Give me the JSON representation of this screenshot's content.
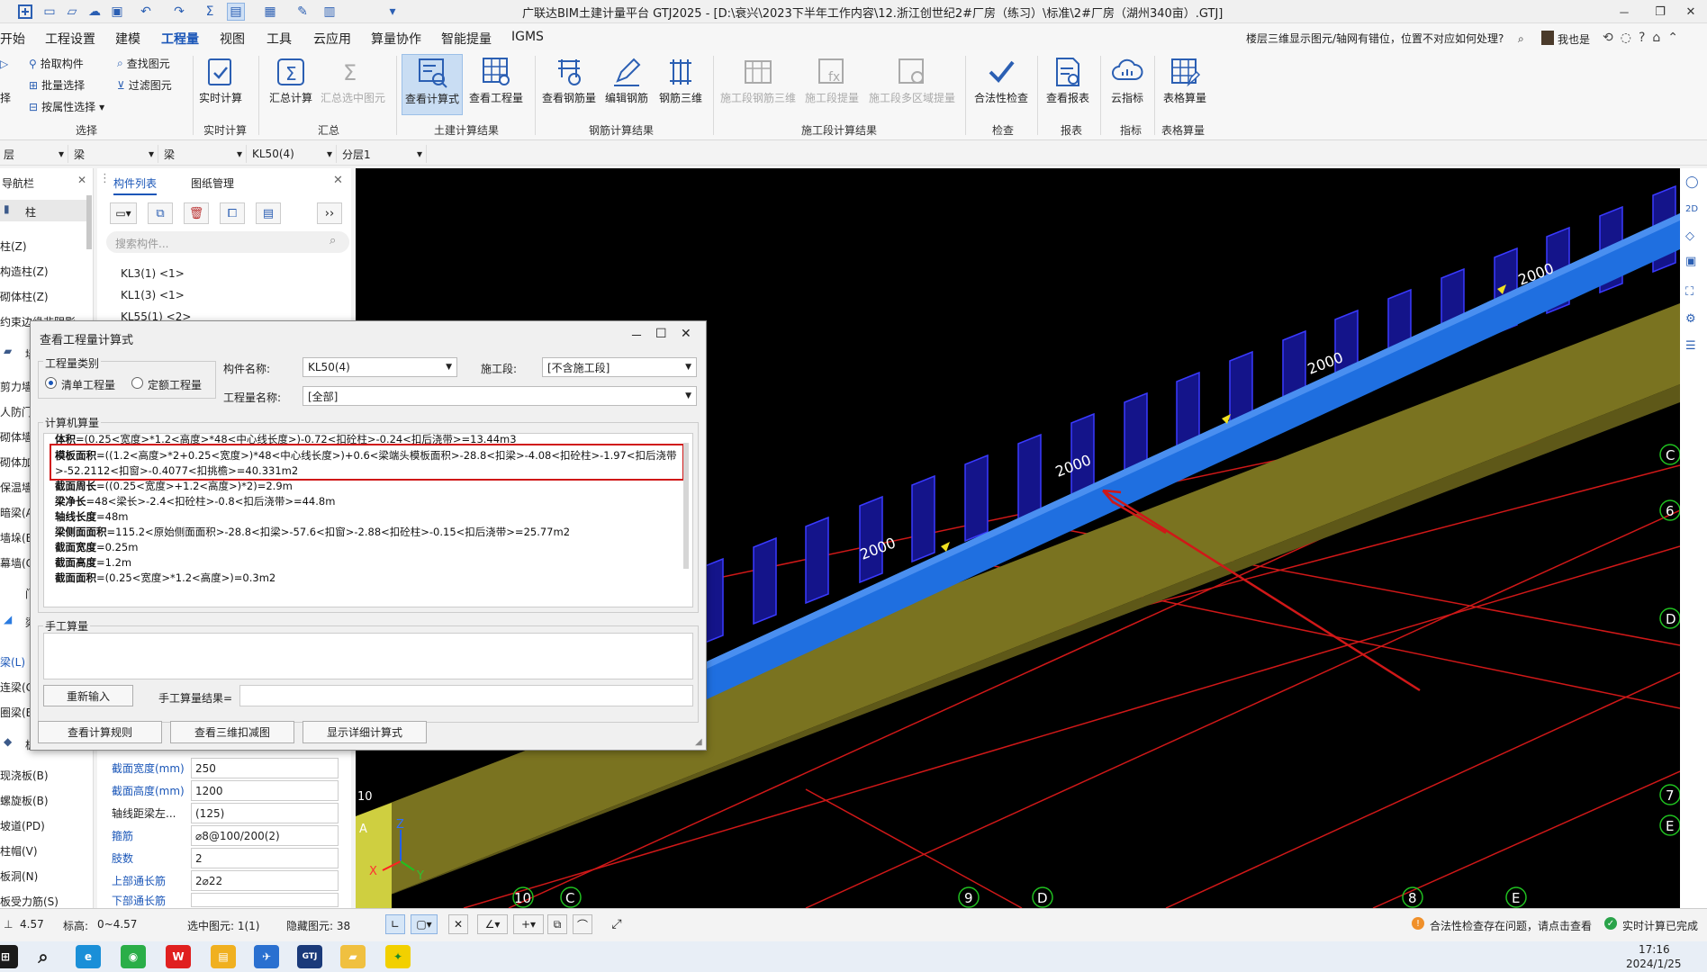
{
  "title_bar": {
    "window_title": "广联达BIM土建计量平台 GTJ2025 - [D:\\衰兴\\2023下半年工作内容\\12.浙江创世纪2#厂房（练习）\\标准\\2#厂房（湖州340亩）.GTJ]",
    "minimize": "－",
    "restore": "❐",
    "close": "✕"
  },
  "menu": {
    "items": [
      "开始",
      "工程设置",
      "建模",
      "工程量",
      "视图",
      "工具",
      "云应用",
      "算量协作",
      "智能提量",
      "IGMS"
    ],
    "active_index": 3,
    "help_question": "楼层三维显示图元/轴网有错位，位置不对应如何处理?",
    "user": "我也是"
  },
  "ribbon": {
    "select_group": {
      "pick": "拾取构件",
      "batch": "批量选择",
      "attr": "按属性选择",
      "find": "查找图元",
      "filter": "过滤图元",
      "left_partial": "择",
      "label": "选择"
    },
    "realtime_group": {
      "btn": "实时计算",
      "label": "实时计算"
    },
    "summary_group": {
      "calc": "汇总计算",
      "calc_sel": "汇总选中图元",
      "label": "汇总"
    },
    "civil_group": {
      "view_formula": "查看计算式",
      "view_qty": "查看工程量",
      "label": "土建计算结果"
    },
    "rebar_group": {
      "view_rebar": "查看钢筋量",
      "edit_rebar": "编辑钢筋",
      "rebar3d": "钢筋三维",
      "label": "钢筋计算结果"
    },
    "stage_group": {
      "s1": "施工段钢筋三维",
      "s2": "施工段提量",
      "s3": "施工段多区域提量",
      "label": "施工段计算结果"
    },
    "check_group": {
      "btn": "合法性检查",
      "label": "检查"
    },
    "report_group": {
      "btn": "查看报表",
      "label": "报表"
    },
    "index_group": {
      "btn": "云指标",
      "label": "指标"
    },
    "table_group": {
      "btn": "表格算量",
      "label": "表格算量"
    }
  },
  "filter_row": {
    "d0": "层",
    "d1": "梁",
    "d2": "梁",
    "d3": "KL50(4)",
    "d4": "分层1"
  },
  "nav": {
    "title": "导航栏",
    "items": [
      "柱",
      "柱(Z)",
      "构造柱(Z)",
      "砌体柱(Z)",
      "约束边缘非阴影",
      "墙",
      "剪力墙",
      "人防门",
      "砌体墙",
      "砌体加",
      "保温墙",
      "暗梁(A",
      "墙垛(E",
      "幕墙(C",
      "门",
      "梁",
      "梁(L)",
      "连梁(G",
      "圈梁(E",
      "板",
      "现浇板(B)",
      "螺旋板(B)",
      "坡道(PD)",
      "柱帽(V)",
      "板洞(N)",
      "板受力筋(S)"
    ]
  },
  "complist": {
    "tab1": "构件列表",
    "tab2": "图纸管理",
    "search_placeholder": "搜索构件...",
    "items": [
      "KL3(1) <1>",
      "KL1(3) <1>",
      "KL55(1) <2>"
    ]
  },
  "props": [
    {
      "k": "截面宽度(mm)",
      "v": "250",
      "blue": true
    },
    {
      "k": "截面高度(mm)",
      "v": "1200",
      "blue": true
    },
    {
      "k": "轴线距梁左...",
      "v": "(125)",
      "blue": false
    },
    {
      "k": "箍筋",
      "v": "⌀8@100/200(2)",
      "blue": true
    },
    {
      "k": "肢数",
      "v": "2",
      "blue": true
    },
    {
      "k": "上部通长筋",
      "v": "2⌀22",
      "blue": true
    },
    {
      "k": "下部通长筋",
      "v": "",
      "blue": true
    }
  ],
  "dialog": {
    "title": "查看工程量计算式",
    "category_legend": "工程量类别",
    "radio1": "清单工程量",
    "radio2": "定额工程量",
    "comp_name_label": "构件名称:",
    "comp_name": "KL50(4)",
    "stage_label": "施工段:",
    "stage": "[不含施工段]",
    "qty_name_label": "工程量名称:",
    "qty_name": "[全部]",
    "computer_legend": "计算机算量",
    "formulas": [
      {
        "k": "体积",
        "v": "=(0.25<宽度>*1.2<高度>*48<中心线长度>)-0.72<扣砼柱>-0.24<扣后浇带>=13.44m3"
      },
      {
        "k": "模板面积",
        "v": "=((1.2<高度>*2+0.25<宽度>)*48<中心线长度>)+0.6<梁端头模板面积>-28.8<扣梁>-4.08<扣砼柱>-1.97<扣后浇带"
      },
      {
        "k": "",
        "v": ">-52.2112<扣窗>-0.4077<扣挑檐>=40.331m2"
      },
      {
        "k": "截面周长",
        "v": "=((0.25<宽度>+1.2<高度>)*2)=2.9m"
      },
      {
        "k": "梁净长",
        "v": "=48<梁长>-2.4<扣砼柱>-0.8<扣后浇带>=44.8m"
      },
      {
        "k": "轴线长度",
        "v": "=48m"
      },
      {
        "k": "梁侧面面积",
        "v": "=115.2<原始侧面面积>-28.8<扣梁>-57.6<扣窗>-2.88<扣砼柱>-0.15<扣后浇带>=25.77m2"
      },
      {
        "k": "截面宽度",
        "v": "=0.25m"
      },
      {
        "k": "截面高度",
        "v": "=1.2m"
      },
      {
        "k": "截面面积",
        "v": "=(0.25<宽度>*1.2<高度>)=0.3m2"
      }
    ],
    "manual_legend": "手工算量",
    "reinput": "重新输入",
    "manual_result_label": "手工算量结果=",
    "btn_rules": "查看计算规则",
    "btn_3d": "查看三维扣减图",
    "btn_detail": "显示详细计算式"
  },
  "canvas": {
    "beam_labels": [
      "2000",
      "2000",
      "2000",
      "2000",
      "2000",
      "2000"
    ],
    "axis_bottom": [
      "10",
      "C",
      "9",
      "D",
      "8",
      "E"
    ],
    "axis_right": [
      "C",
      "6",
      "D",
      "7",
      "E"
    ],
    "axis_left": [
      "10",
      "A"
    ],
    "axis_x": "X",
    "axis_y": "Y",
    "axis_z": "Z"
  },
  "status": {
    "floor_height": "4.57",
    "elev_label": "标高:",
    "elev": "0~4.57",
    "selected": "选中图元: 1(1)",
    "hidden": "隐藏图元: 38",
    "legality": "合法性检查存在问题，请点击查看",
    "realtime": "实时计算已完成"
  },
  "taskbar": {
    "time": "17:16",
    "date": "2024/1/25"
  },
  "colors": {
    "accent": "#1a56b8",
    "beam_blue": "#1f6fe0",
    "wall_olive": "#7a7320",
    "window_navy": "#1a1a9a",
    "grid_red": "#d01818",
    "highlight_red": "#d01818"
  }
}
